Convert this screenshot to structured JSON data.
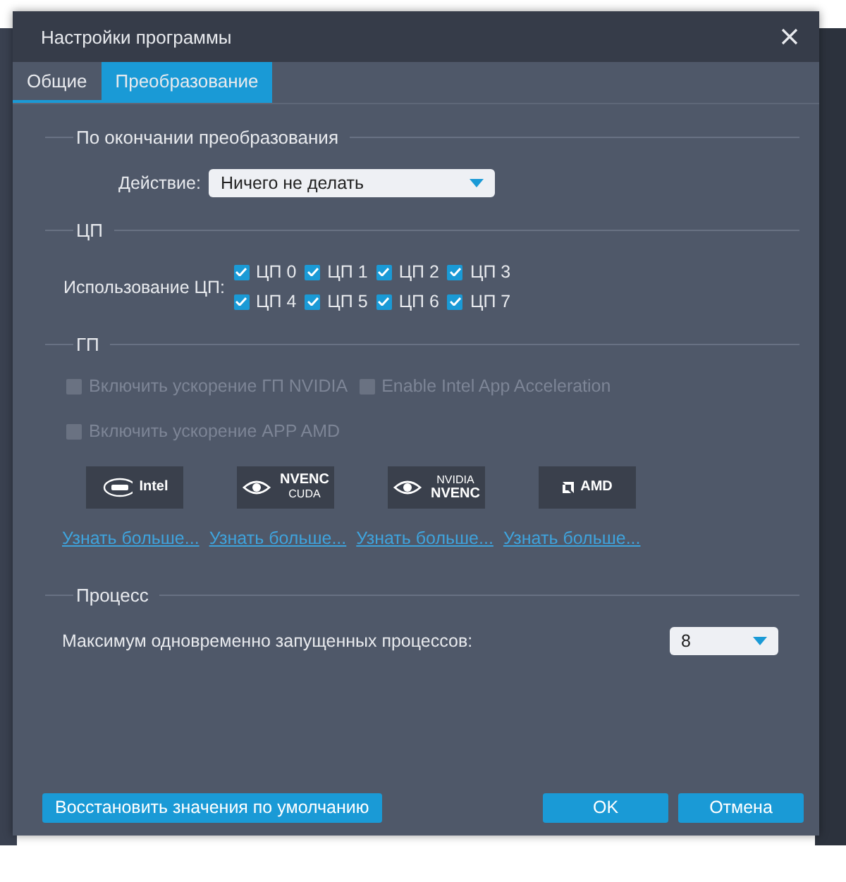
{
  "window": {
    "title": "Настройки программы"
  },
  "tabs": [
    {
      "label": "Общие",
      "selected": false
    },
    {
      "label": "Преобразование",
      "selected": true
    }
  ],
  "sections": [
    {
      "kind": "action",
      "title": "По окончании преобразования",
      "label": "Действие:",
      "value": "Ничего не делать"
    },
    {
      "kind": "cpu",
      "title": "ЦП",
      "label": "Использование ЦП:",
      "cores": [
        {
          "label": "ЦП 0",
          "checked": true
        },
        {
          "label": "ЦП 1",
          "checked": true
        },
        {
          "label": "ЦП 2",
          "checked": true
        },
        {
          "label": "ЦП 3",
          "checked": true
        },
        {
          "label": "ЦП 4",
          "checked": true
        },
        {
          "label": "ЦП 5",
          "checked": true
        },
        {
          "label": "ЦП 6",
          "checked": true
        },
        {
          "label": "ЦП 7",
          "checked": true
        }
      ]
    },
    {
      "kind": "gpu",
      "title": "ГП",
      "options": [
        {
          "label": "Включить ускорение ГП NVIDIA",
          "checked": false,
          "disabled": true
        },
        {
          "label": "Enable Intel App Acceleration",
          "checked": false,
          "disabled": true
        },
        {
          "label": "Включить ускорение APP AMD",
          "checked": false,
          "disabled": true
        }
      ],
      "vendors": [
        {
          "kind": "intel",
          "name": "Intel"
        },
        {
          "kind": "nvenc-cuda",
          "name": "NVENC",
          "sub": "CUDA"
        },
        {
          "kind": "nvidia-nvenc",
          "name": "NVIDIA",
          "sub": "NVENC"
        },
        {
          "kind": "amd",
          "name": "AMD"
        }
      ],
      "links": [
        "Узнать больше...",
        "Узнать больше...",
        "Узнать больше...",
        "Узнать больше..."
      ]
    },
    {
      "kind": "process",
      "title": "Процесс",
      "label": "Максимум одновременно запущенных процессов:",
      "value": "8"
    }
  ],
  "buttons": {
    "restore": "Восстановить значения по умолчанию",
    "ok": "OK",
    "cancel": "Отмена"
  }
}
